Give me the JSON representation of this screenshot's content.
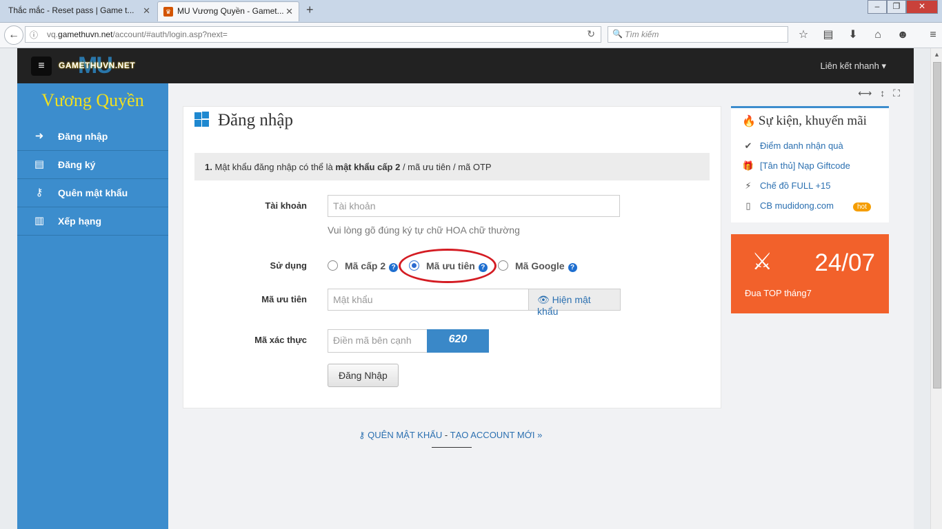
{
  "browser": {
    "tabs": [
      {
        "title": "Thắc mắc - Reset pass | Game t...",
        "active": false
      },
      {
        "title": "MU Vương Quyền - Gamet...",
        "active": true
      }
    ],
    "url_prefix": "vq.",
    "url_domain": "gamethuvn.net",
    "url_path": "/account/#auth/login.asp?next=",
    "search_placeholder": "Tìm kiếm"
  },
  "site": {
    "logo_text": "GAMETHUVN.NET",
    "logo_mu": "MU",
    "quicklink_label": "Liên kết nhanh",
    "brand": "Vương Quyền"
  },
  "sidebar": {
    "items": [
      {
        "label": "Đăng nhập",
        "icon": "sign-in-icon"
      },
      {
        "label": "Đăng ký",
        "icon": "file-icon"
      },
      {
        "label": "Quên mật khẩu",
        "icon": "key-icon"
      },
      {
        "label": "Xếp hạng",
        "icon": "bar-chart-icon"
      }
    ]
  },
  "login": {
    "title": "Đăng nhập",
    "notice_num": "1.",
    "notice_text1": "Mật khẩu đăng nhập có thể là",
    "notice_bold": "mật khẩu cấp 2",
    "notice_text2": "/ mã ưu tiên / mã OTP",
    "account_label": "Tài khoản",
    "account_placeholder": "Tài khoản",
    "account_help": "Vui lòng gõ đúng ký tự chữ HOA chữ thường",
    "use_label": "Sử dụng",
    "options": [
      {
        "label": "Mã cấp 2",
        "selected": false
      },
      {
        "label": "Mã ưu tiên",
        "selected": true
      },
      {
        "label": "Mã Google",
        "selected": false
      }
    ],
    "password_label": "Mã ưu tiên",
    "password_placeholder": "Mật khẩu",
    "show_password": "Hiện mật khẩu",
    "captcha_label": "Mã xác thực",
    "captcha_placeholder": "Điền mã bên cạnh",
    "captcha_text": "620",
    "submit": "Đăng Nhập",
    "forgot_link": "QUÊN MẬT KHẨU",
    "separator": "-",
    "create_link": "TẠO ACCOUNT MỚI »"
  },
  "events": {
    "title": "Sự kiện, khuyến mãi",
    "items": [
      {
        "label": "Điểm danh nhận quà",
        "icon": "check-circle-icon"
      },
      {
        "label": "[Tân thủ] Nạp Giftcode",
        "icon": "gift-icon"
      },
      {
        "label": "Chế đồ FULL +15",
        "icon": "plug-icon"
      },
      {
        "label": "CB mudidong.com",
        "icon": "mobile-icon",
        "badge": "hot"
      }
    ]
  },
  "promo": {
    "date": "24/07",
    "text": "Đua TOP tháng7"
  },
  "colors": {
    "sidebar": "#3c8dcd",
    "promo": "#f2612b",
    "highlight": "#d41c23"
  }
}
